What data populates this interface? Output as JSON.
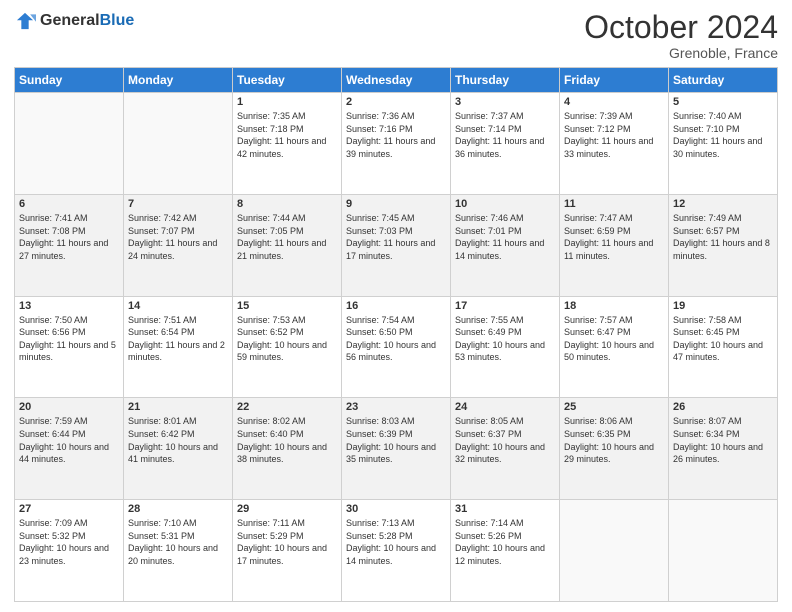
{
  "header": {
    "logo_general": "General",
    "logo_blue": "Blue",
    "title": "October 2024",
    "location": "Grenoble, France"
  },
  "days_of_week": [
    "Sunday",
    "Monday",
    "Tuesday",
    "Wednesday",
    "Thursday",
    "Friday",
    "Saturday"
  ],
  "weeks": [
    [
      {
        "day": "",
        "info": ""
      },
      {
        "day": "",
        "info": ""
      },
      {
        "day": "1",
        "info": "Sunrise: 7:35 AM\nSunset: 7:18 PM\nDaylight: 11 hours and 42 minutes."
      },
      {
        "day": "2",
        "info": "Sunrise: 7:36 AM\nSunset: 7:16 PM\nDaylight: 11 hours and 39 minutes."
      },
      {
        "day": "3",
        "info": "Sunrise: 7:37 AM\nSunset: 7:14 PM\nDaylight: 11 hours and 36 minutes."
      },
      {
        "day": "4",
        "info": "Sunrise: 7:39 AM\nSunset: 7:12 PM\nDaylight: 11 hours and 33 minutes."
      },
      {
        "day": "5",
        "info": "Sunrise: 7:40 AM\nSunset: 7:10 PM\nDaylight: 11 hours and 30 minutes."
      }
    ],
    [
      {
        "day": "6",
        "info": "Sunrise: 7:41 AM\nSunset: 7:08 PM\nDaylight: 11 hours and 27 minutes."
      },
      {
        "day": "7",
        "info": "Sunrise: 7:42 AM\nSunset: 7:07 PM\nDaylight: 11 hours and 24 minutes."
      },
      {
        "day": "8",
        "info": "Sunrise: 7:44 AM\nSunset: 7:05 PM\nDaylight: 11 hours and 21 minutes."
      },
      {
        "day": "9",
        "info": "Sunrise: 7:45 AM\nSunset: 7:03 PM\nDaylight: 11 hours and 17 minutes."
      },
      {
        "day": "10",
        "info": "Sunrise: 7:46 AM\nSunset: 7:01 PM\nDaylight: 11 hours and 14 minutes."
      },
      {
        "day": "11",
        "info": "Sunrise: 7:47 AM\nSunset: 6:59 PM\nDaylight: 11 hours and 11 minutes."
      },
      {
        "day": "12",
        "info": "Sunrise: 7:49 AM\nSunset: 6:57 PM\nDaylight: 11 hours and 8 minutes."
      }
    ],
    [
      {
        "day": "13",
        "info": "Sunrise: 7:50 AM\nSunset: 6:56 PM\nDaylight: 11 hours and 5 minutes."
      },
      {
        "day": "14",
        "info": "Sunrise: 7:51 AM\nSunset: 6:54 PM\nDaylight: 11 hours and 2 minutes."
      },
      {
        "day": "15",
        "info": "Sunrise: 7:53 AM\nSunset: 6:52 PM\nDaylight: 10 hours and 59 minutes."
      },
      {
        "day": "16",
        "info": "Sunrise: 7:54 AM\nSunset: 6:50 PM\nDaylight: 10 hours and 56 minutes."
      },
      {
        "day": "17",
        "info": "Sunrise: 7:55 AM\nSunset: 6:49 PM\nDaylight: 10 hours and 53 minutes."
      },
      {
        "day": "18",
        "info": "Sunrise: 7:57 AM\nSunset: 6:47 PM\nDaylight: 10 hours and 50 minutes."
      },
      {
        "day": "19",
        "info": "Sunrise: 7:58 AM\nSunset: 6:45 PM\nDaylight: 10 hours and 47 minutes."
      }
    ],
    [
      {
        "day": "20",
        "info": "Sunrise: 7:59 AM\nSunset: 6:44 PM\nDaylight: 10 hours and 44 minutes."
      },
      {
        "day": "21",
        "info": "Sunrise: 8:01 AM\nSunset: 6:42 PM\nDaylight: 10 hours and 41 minutes."
      },
      {
        "day": "22",
        "info": "Sunrise: 8:02 AM\nSunset: 6:40 PM\nDaylight: 10 hours and 38 minutes."
      },
      {
        "day": "23",
        "info": "Sunrise: 8:03 AM\nSunset: 6:39 PM\nDaylight: 10 hours and 35 minutes."
      },
      {
        "day": "24",
        "info": "Sunrise: 8:05 AM\nSunset: 6:37 PM\nDaylight: 10 hours and 32 minutes."
      },
      {
        "day": "25",
        "info": "Sunrise: 8:06 AM\nSunset: 6:35 PM\nDaylight: 10 hours and 29 minutes."
      },
      {
        "day": "26",
        "info": "Sunrise: 8:07 AM\nSunset: 6:34 PM\nDaylight: 10 hours and 26 minutes."
      }
    ],
    [
      {
        "day": "27",
        "info": "Sunrise: 7:09 AM\nSunset: 5:32 PM\nDaylight: 10 hours and 23 minutes."
      },
      {
        "day": "28",
        "info": "Sunrise: 7:10 AM\nSunset: 5:31 PM\nDaylight: 10 hours and 20 minutes."
      },
      {
        "day": "29",
        "info": "Sunrise: 7:11 AM\nSunset: 5:29 PM\nDaylight: 10 hours and 17 minutes."
      },
      {
        "day": "30",
        "info": "Sunrise: 7:13 AM\nSunset: 5:28 PM\nDaylight: 10 hours and 14 minutes."
      },
      {
        "day": "31",
        "info": "Sunrise: 7:14 AM\nSunset: 5:26 PM\nDaylight: 10 hours and 12 minutes."
      },
      {
        "day": "",
        "info": ""
      },
      {
        "day": "",
        "info": ""
      }
    ]
  ]
}
